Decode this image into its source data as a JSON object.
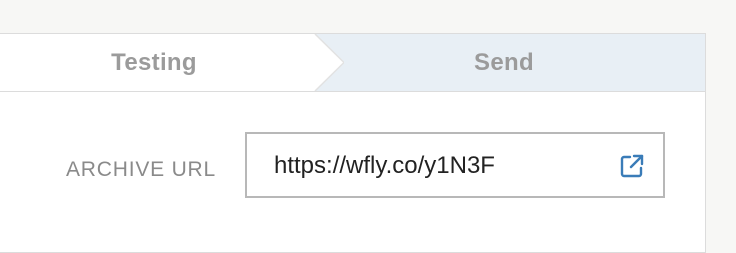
{
  "steps": {
    "testing_label": "Testing",
    "send_label": "Send"
  },
  "archive": {
    "label": "ARCHIVE URL",
    "url": "https://wfly.co/y1N3F",
    "open_icon": "external-link-icon"
  },
  "colors": {
    "active_step_bg": "#e8eff5",
    "step_text": "#9b9b9b",
    "link_icon": "#3a7cb8"
  }
}
